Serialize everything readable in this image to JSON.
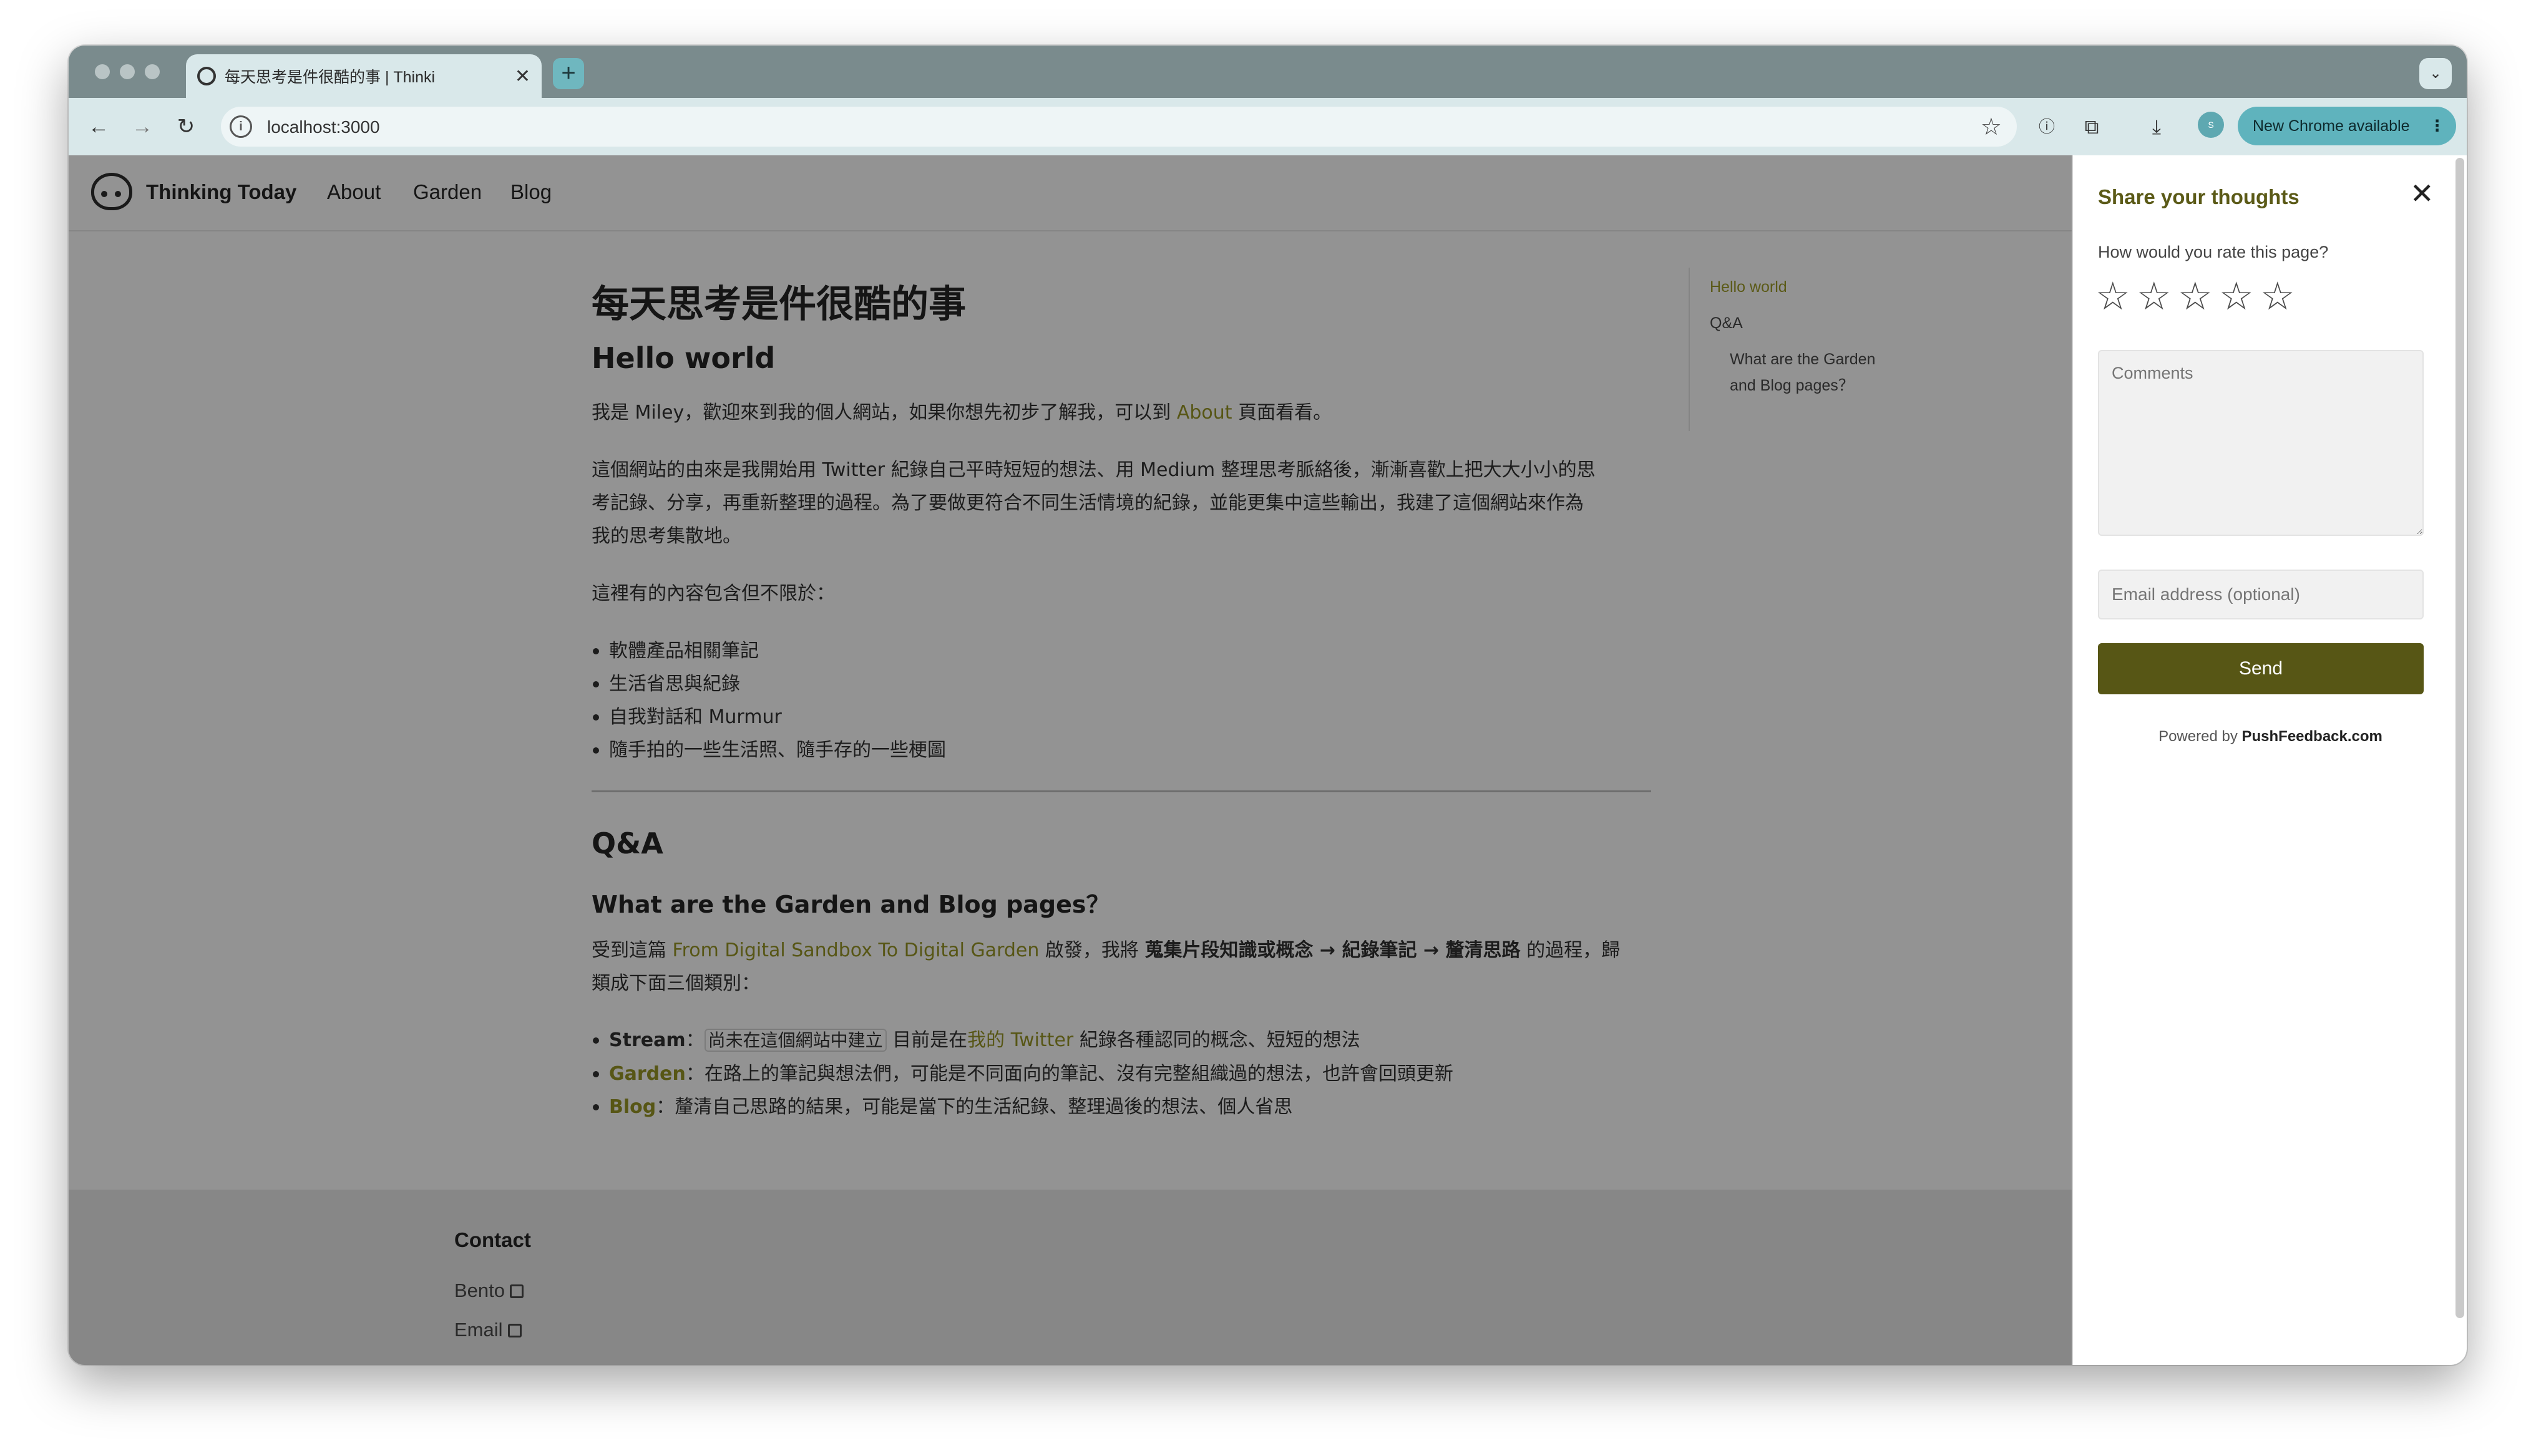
{
  "browser": {
    "tab_title": "每天思考是件很酷的事 | Thinki",
    "url": "localhost:3000",
    "update_label": "New Chrome available",
    "profile_label": "S"
  },
  "site": {
    "brand": "Thinking Today",
    "nav": [
      "About",
      "Garden",
      "Blog"
    ]
  },
  "article": {
    "title": "每天思考是件很酷的事",
    "hello_heading": "Hello world",
    "intro_prefix": "我是 Miley，歡迎來到我的個人網站，如果你想先初步了解我，可以到 ",
    "intro_link": "About",
    "intro_suffix": " 頁面看看。",
    "origin_line1": "這個網站的由來是我開始用 Twitter 紀錄自己平時短短的想法、用 Medium 整理思考脈絡後，漸漸喜歡上把大大小小的思",
    "origin_line2": "考記錄、分享，再重新整理的過程。為了要做更符合不同生活情境的紀錄，並能更集中這些輸出，我建了這個網站來作為",
    "origin_line3": "我的思考集散地。",
    "contents_intro": "這裡有的內容包含但不限於：",
    "contents": [
      "軟體產品相關筆記",
      "生活省思與紀錄",
      "自我對話和 Murmur",
      "隨手拍的一些生活照、隨手存的一些梗圖"
    ],
    "qa_heading": "Q&A",
    "qa_question": "What are the Garden and Blog pages？",
    "garden_p_prefix": "受到這篇 ",
    "garden_p_link": "From Digital Sandbox To Digital Garden",
    "garden_p_mid": " 啟發，我將 ",
    "garden_p_bold": "蒐集片段知識或概念 → 紀錄筆記 → 釐清思路",
    "garden_p_suffix": " 的過程，歸",
    "garden_p_line2": "類成下面三個類別：",
    "stream_label": "Stream",
    "stream_sep": "：",
    "stream_code": "尚未在這個網站中建立",
    "stream_mid": " 目前是在",
    "stream_link": "我的 Twitter",
    "stream_suffix": " 紀錄各種認同的概念、短短的想法",
    "garden_label": "Garden",
    "garden_text": "：在路上的筆記與想法們，可能是不同面向的筆記、沒有完整組織過的想法，也許會回頭更新",
    "blog_label": "Blog",
    "blog_text": "：釐清自己思路的結果，可能是當下的生活紀錄、整理過後的想法、個人省思"
  },
  "toc": {
    "items": [
      "Hello world",
      "Q&A",
      "What are the Garden",
      "and Blog pages？"
    ]
  },
  "footer": {
    "title": "Contact",
    "links": [
      "Bento",
      "Email"
    ]
  },
  "feedback": {
    "title": "Share your thoughts",
    "question": "How would you rate this page?",
    "rating": 0,
    "rating_max": 5,
    "comments_placeholder": "Comments",
    "email_placeholder": "Email address (optional)",
    "send_label": "Send",
    "powered_prefix": "Powered by ",
    "powered_brand": "PushFeedback.com"
  },
  "colors": {
    "accent": "#575615",
    "site_bg": "#939393",
    "browser_chrome": "#d9e8ea"
  }
}
